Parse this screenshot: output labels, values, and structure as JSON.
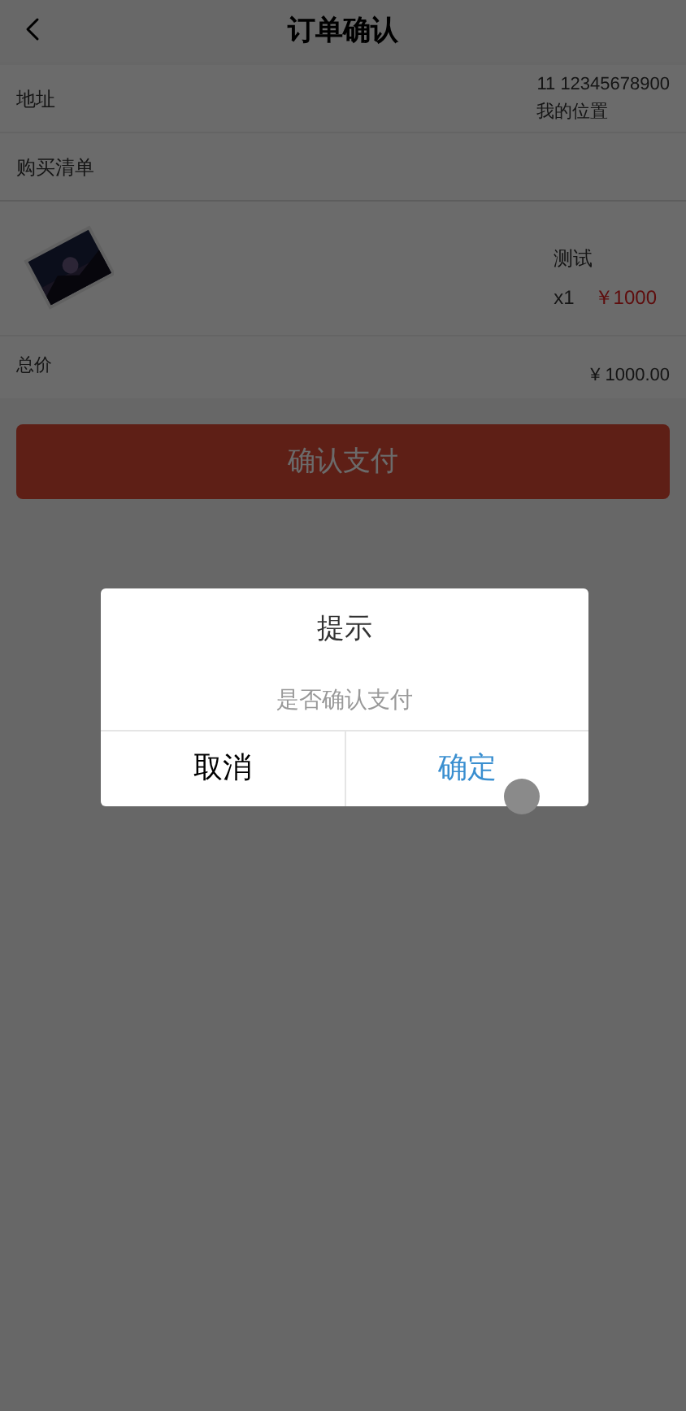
{
  "header": {
    "title": "订单确认"
  },
  "address": {
    "label": "地址",
    "contact": "11 12345678900",
    "location": "我的位置"
  },
  "cart": {
    "label": "购买清单",
    "items": [
      {
        "kind": "picture",
        "name": "测试",
        "quantity": "x1",
        "price": "￥1000"
      }
    ]
  },
  "total": {
    "label": "总价",
    "amount": "¥ 1000.00"
  },
  "pay_button": "确认支付",
  "dialog": {
    "title": "提示",
    "message": "是否确认支付",
    "buttons": [
      {
        "label": "取消",
        "kind": "cancel"
      },
      {
        "label": "确定",
        "kind": "confirm"
      }
    ]
  }
}
